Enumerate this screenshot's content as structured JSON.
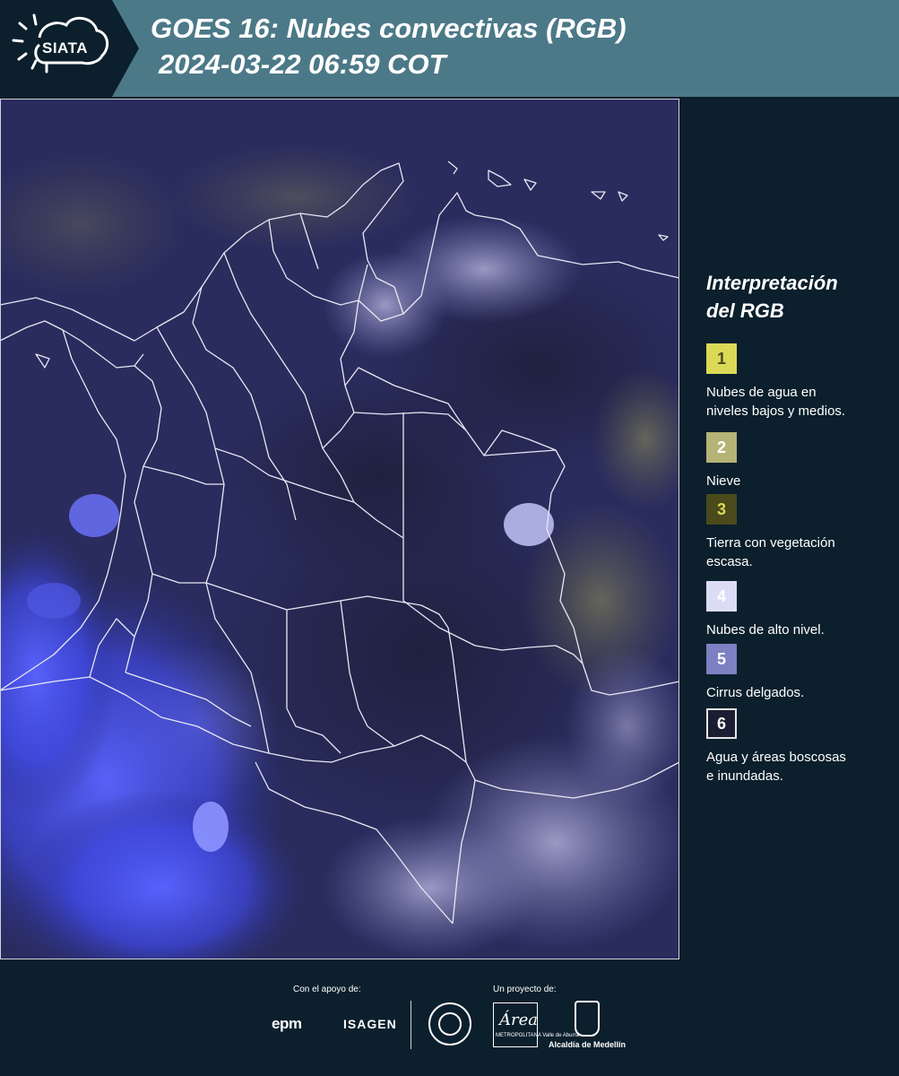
{
  "header": {
    "logo_text": "SIATA",
    "title_line1": "GOES 16: Nubes convectivas (RGB)",
    "title_line2": "2024-03-22 06:59 COT",
    "background_color": "#4c7988",
    "logo_block_color": "#0b1f2c"
  },
  "map": {
    "background_color": "#25285a",
    "border_color": "#ffffff"
  },
  "legend": {
    "title_line1": "Interpretación",
    "title_line2": "del RGB",
    "items": [
      {
        "number": "1",
        "label_line1": "Nubes de agua en",
        "label_line2": "niveles bajos y medios.",
        "color": "#dcd957"
      },
      {
        "number": "2",
        "label_line1": "Nieve",
        "label_line2": "",
        "color": "#b6b376"
      },
      {
        "number": "3",
        "label_line1": "Tierra con vegetación",
        "label_line2": "escasa.",
        "color": "#4a4a1c"
      },
      {
        "number": "4",
        "label_line1": "Nubes de alto nivel.",
        "label_line2": "",
        "color": "#dcdcf6"
      },
      {
        "number": "5",
        "label_line1": "Cirrus delgados.",
        "label_line2": "",
        "color": "#7d80c2"
      },
      {
        "number": "6",
        "label_line1": "Agua y áreas boscosas",
        "label_line2": "e inundadas.",
        "color": "#1b1e33"
      }
    ]
  },
  "footer": {
    "support_label": "Con el apoyo de:",
    "project_label": "Un proyecto de:",
    "sponsor_1": "epm",
    "sponsor_2": "ISAGEN",
    "area_word": "Área",
    "area_sub": "METROPOLITANA Valle de Aburrá",
    "alcaldia": "Alcaldía de Medellín"
  }
}
